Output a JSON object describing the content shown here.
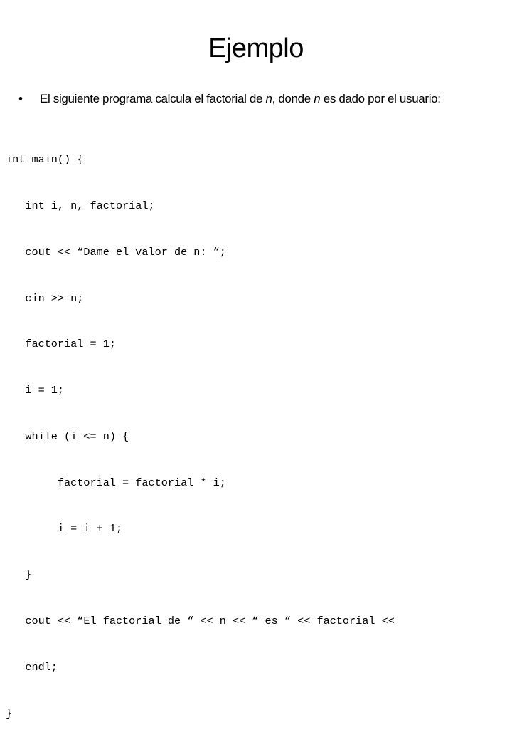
{
  "slide": {
    "title": "Ejemplo",
    "bullet": {
      "marker": "•",
      "text_before": "El siguiente programa calcula el factorial de ",
      "var1": "n",
      "text_middle": ", donde ",
      "var2": "n",
      "text_after": " es dado por el usuario:"
    },
    "code_lines": [
      "int main() {",
      "   int i, n, factorial;",
      "   cout << “Dame el valor de n: “;",
      "   cin >> n;",
      "   factorial = 1;",
      "   i = 1;",
      "   while (i <= n) {",
      "        factorial = factorial * i;",
      "        i = i + 1;",
      "   }",
      "   cout << “El factorial de “ << n << “ es “ << factorial <<",
      "   endl;",
      "}"
    ]
  }
}
